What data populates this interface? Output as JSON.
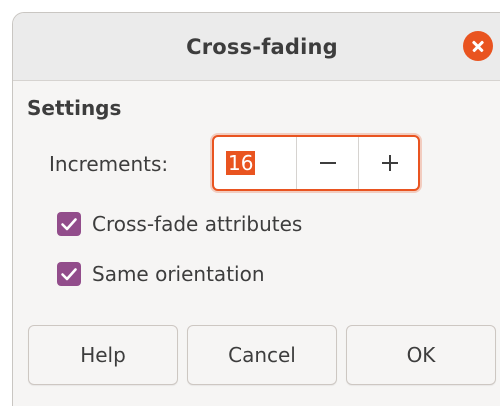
{
  "window": {
    "title": "Cross-fading"
  },
  "settings": {
    "section_title": "Settings",
    "increments": {
      "label": "Increments:",
      "value": "16"
    },
    "options": [
      {
        "label": "Cross-fade attributes",
        "checked": true
      },
      {
        "label": "Same orientation",
        "checked": true
      }
    ]
  },
  "buttons": {
    "help": "Help",
    "cancel": "Cancel",
    "ok": "OK"
  },
  "colors": {
    "accent": "#e95420",
    "checkbox": "#924d8b",
    "text": "#3d3d3d"
  },
  "icons": {
    "close": "close-icon",
    "minus": "minus-icon",
    "plus": "plus-icon",
    "check": "checkmark-icon"
  }
}
